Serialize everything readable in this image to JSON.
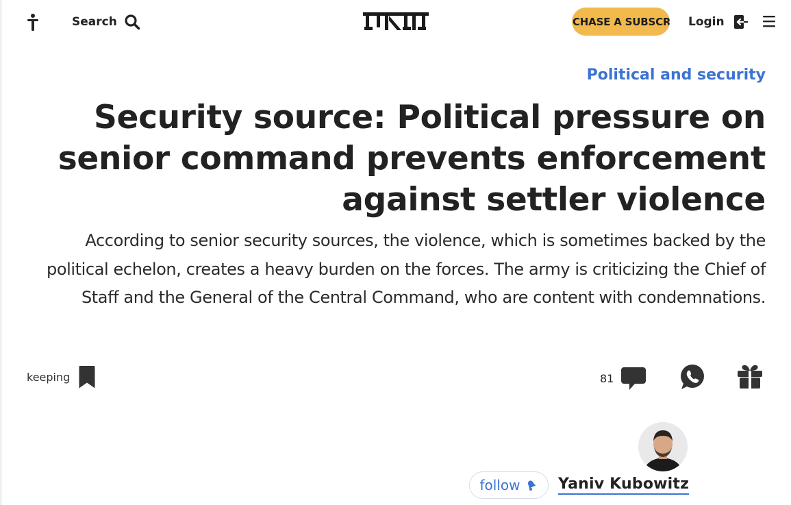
{
  "header": {
    "search_label": "Search",
    "logo_alt": "הארץ",
    "subscribe_label": "CHASE A SUBSCRIBE",
    "login_label": "Login"
  },
  "article": {
    "section": "Political and security",
    "headline": "Security source: Political pressure on senior command prevents enforcement against settler violence",
    "subtitle": "According to senior security sources, the violence, which is sometimes backed by the political echelon, creates a heavy burden on the forces. The army is criticizing the Chief of Staff and the General of the Central Command, who are content with condemnations."
  },
  "toolbar": {
    "keeping_label": "keeping",
    "comment_count": "81"
  },
  "author": {
    "name": "Yaniv Kubowitz",
    "follow_label": "follow"
  },
  "colors": {
    "accent_blue": "#3b73d3",
    "subscribe_bg": "#f2b94c",
    "text": "#222222"
  },
  "icons": {
    "accessibility": "accessibility-icon",
    "search": "search-icon",
    "login": "login-icon",
    "menu": "hamburger-menu-icon",
    "bookmark": "bookmark-icon",
    "comments": "comment-bubble-icon",
    "whatsapp": "whatsapp-icon",
    "gift": "gift-icon",
    "bell": "bell-icon"
  }
}
